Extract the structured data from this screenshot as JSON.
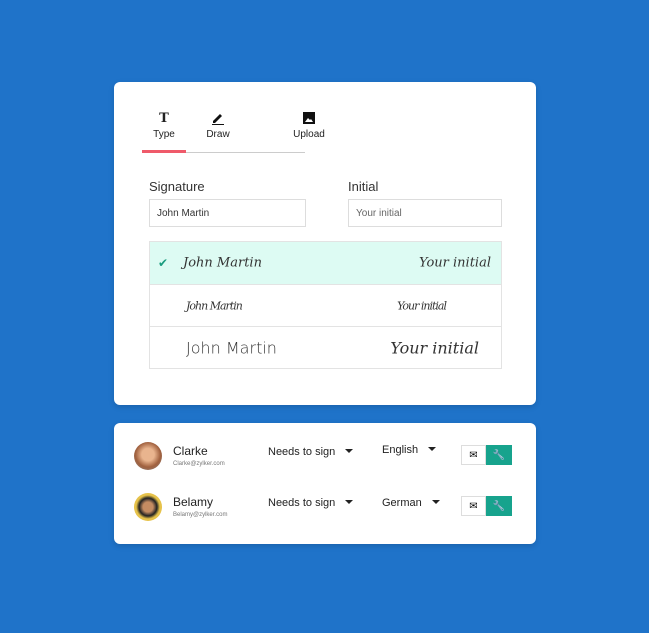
{
  "tabs": [
    {
      "label": "Type",
      "icon": "text-icon",
      "active": true
    },
    {
      "label": "Draw",
      "icon": "pencil-icon"
    },
    {
      "label": "Upload",
      "icon": "image-icon"
    }
  ],
  "signature": {
    "label": "Signature",
    "value": "John Martin"
  },
  "initial": {
    "label": "Initial",
    "placeholder": "Your initial"
  },
  "options": [
    {
      "name": "John Martin",
      "initial": "Your initial",
      "selected": true
    },
    {
      "name": "John Martin",
      "initial": "Your initial"
    },
    {
      "name": "John Martin",
      "initial": "Your initial"
    }
  ],
  "recipients": [
    {
      "name": "Clarke",
      "email": "Clarke@zylker.com",
      "role": "Needs to sign",
      "language": "English"
    },
    {
      "name": "Belamy",
      "email": "Belamy@zylker.com",
      "role": "Needs to sign",
      "language": "German"
    }
  ],
  "colors": {
    "background": "#1f73c9",
    "accent": "#17a38d",
    "tab_indicator": "#ef5a6a",
    "selected_row": "#ddfbf3"
  }
}
